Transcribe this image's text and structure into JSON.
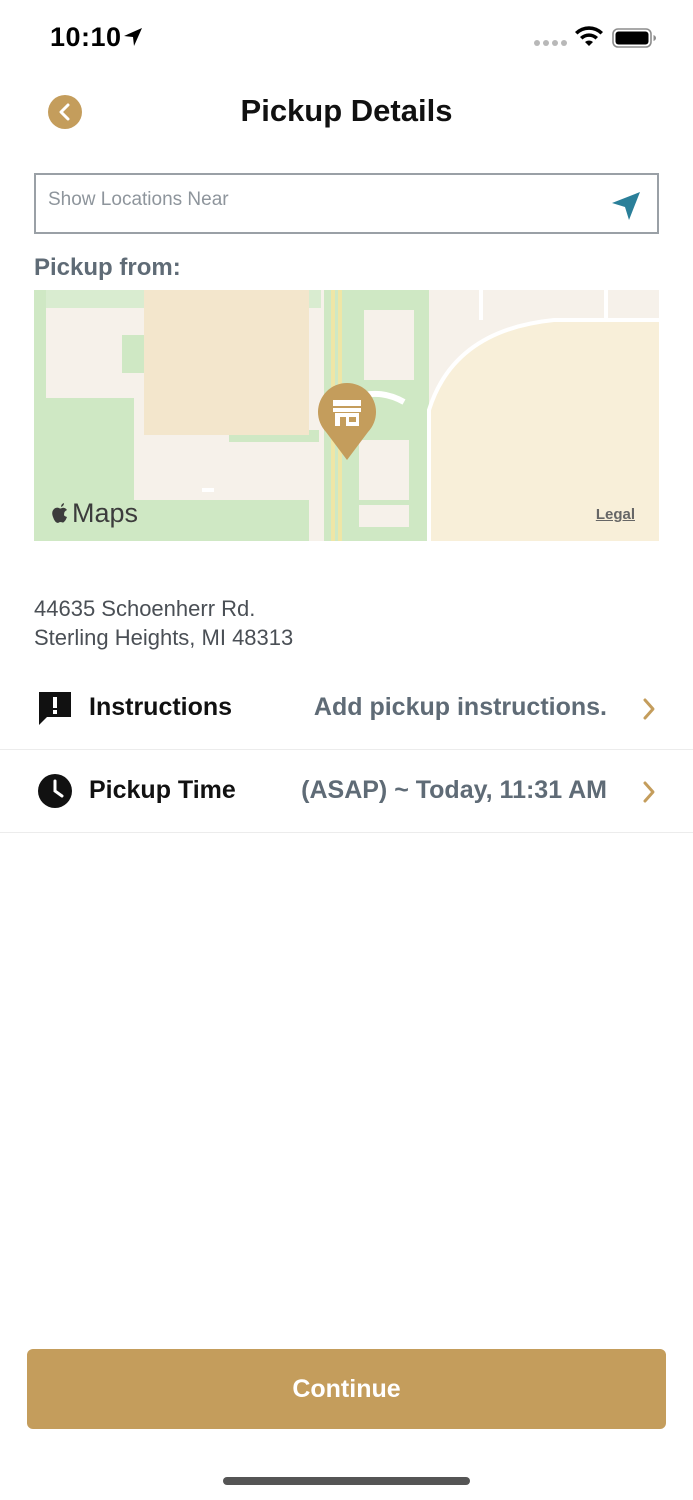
{
  "status_bar": {
    "time": "10:10"
  },
  "header": {
    "title": "Pickup Details"
  },
  "search": {
    "placeholder": "Show Locations Near",
    "value": ""
  },
  "pickup": {
    "section_label": "Pickup from:",
    "map": {
      "provider_label": "Maps",
      "legal_label": "Legal"
    },
    "address_line1": "44635 Schoenherr Rd.",
    "address_line2": "Sterling Heights, MI 48313"
  },
  "rows": {
    "instructions": {
      "label": "Instructions",
      "value": "Add pickup instructions."
    },
    "pickup_time": {
      "label": "Pickup Time",
      "value": "(ASAP) ~ Today, 11:31 AM"
    }
  },
  "footer": {
    "continue_label": "Continue"
  },
  "colors": {
    "accent": "#c49d5c",
    "muted_text": "#5f6b76",
    "nav_icon": "#2a7f99"
  },
  "icons": {
    "back": "chevron-left-icon",
    "nav": "navigation-arrow-icon",
    "instructions": "message-alert-icon",
    "time": "clock-icon",
    "chevron": "chevron-right-icon",
    "pin": "store-pin-icon"
  }
}
